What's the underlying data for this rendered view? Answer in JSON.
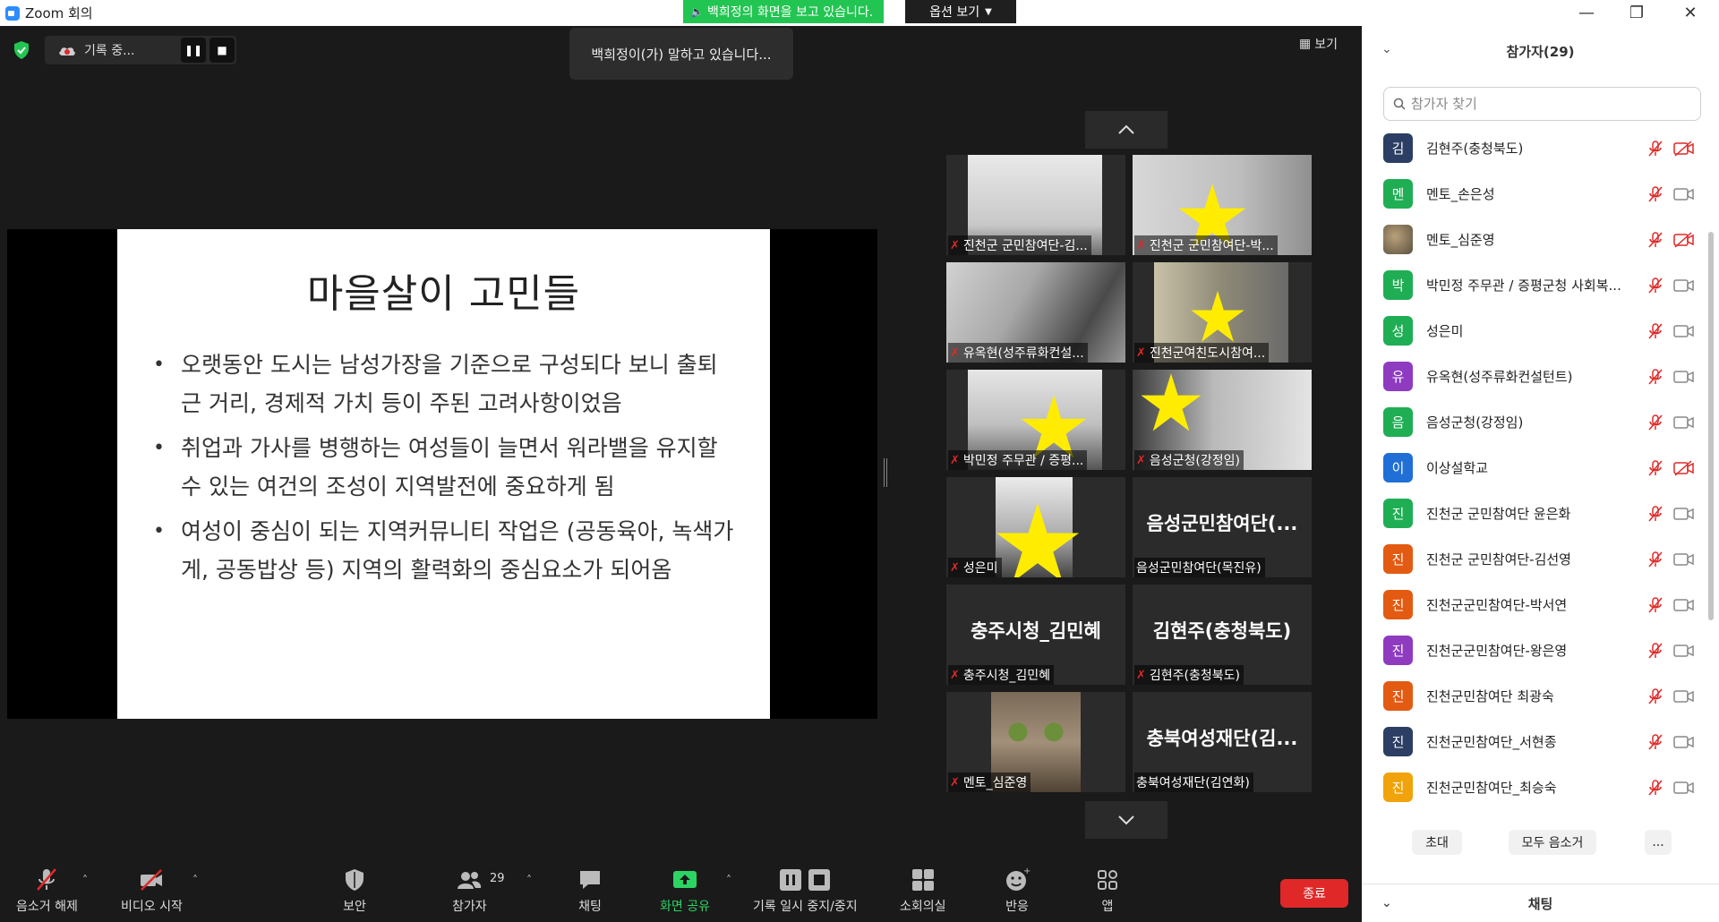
{
  "window": {
    "title": "Zoom 회의",
    "minimize": "—",
    "maximize": "❐",
    "close": "✕"
  },
  "banner": {
    "sharing_text": "백희정의 화면을 보고 있습니다.",
    "view_options": "옵션 보기"
  },
  "recording": {
    "text": "기록 중..."
  },
  "speaking": "백희정이(가) 말하고 있습니다...",
  "view_button": "보기",
  "slide": {
    "title": "마을살이 고민들",
    "bullets": [
      "오랫동안 도시는 남성가장을 기준으로 구성되다 보니 출퇴근 거리, 경제적 가치 등이 주된 고려사항이었음",
      "취업과 가사를 병행하는 여성들이 늘면서 워라밸을 유지할 수 있는 여건의 조성이 지역발전에 중요하게 됨",
      "여성이 중심이 되는 지역커뮤니티 작업은 (공동육아, 녹색가게, 공동밥상 등) 지역의 활력화의 중심요소가 되어옴"
    ]
  },
  "gallery": {
    "tiles": [
      {
        "label": "진천군 군민참여단-김...",
        "big": ""
      },
      {
        "label": "진천군 군민참여단-박...",
        "big": ""
      },
      {
        "label": "유옥현(성주류화컨설...",
        "big": ""
      },
      {
        "label": "진천군여친도시참여...",
        "big": ""
      },
      {
        "label": "박민정 주무관 / 증평...",
        "big": ""
      },
      {
        "label": "음성군청(강정임)",
        "big": ""
      },
      {
        "label": "성은미",
        "big": ""
      },
      {
        "label": "음성군민참여단(목진유)",
        "big": "음성군민참여단(..."
      },
      {
        "label": "충주시청_김민혜",
        "big": "충주시청_김민혜"
      },
      {
        "label": "김현주(충청북도)",
        "big": "김현주(충청북도)"
      },
      {
        "label": "멘토_심준영",
        "big": ""
      },
      {
        "label": "충북여성재단(김연화)",
        "big": "충북여성재단(김..."
      }
    ]
  },
  "toolbar": {
    "unmute": "음소거 해제",
    "start_video": "비디오 시작",
    "security": "보안",
    "participants": "참가자",
    "participants_count": "29",
    "chat": "채팅",
    "share_screen": "화면 공유",
    "pause_record": "기록 일시 중지/중지",
    "breakout": "소회의실",
    "reactions": "반응",
    "apps": "앱",
    "end": "종료"
  },
  "panel": {
    "header": "참가자(29)",
    "search_placeholder": "참가자 찾기",
    "participants": [
      {
        "initial": "김",
        "name": "김현주(충청북도)",
        "color": "#2c3e63",
        "cam_off": true
      },
      {
        "initial": "멘",
        "name": "멘토_손은성",
        "color": "#1fae54",
        "cam_off": false
      },
      {
        "initial": "",
        "name": "멘토_심준영",
        "color": "#6b6558",
        "cam_off": true
      },
      {
        "initial": "박",
        "name": "박민정 주무관 / 증평군청 사회복...",
        "color": "#1fae54",
        "cam_off": false
      },
      {
        "initial": "성",
        "name": "성은미",
        "color": "#1fae54",
        "cam_off": false
      },
      {
        "initial": "유",
        "name": "유옥현(성주류화컨설턴트)",
        "color": "#8e3bc0",
        "cam_off": false
      },
      {
        "initial": "음",
        "name": "음성군청(강정임)",
        "color": "#1fae54",
        "cam_off": false
      },
      {
        "initial": "이",
        "name": "이상설학교",
        "color": "#1f6fd6",
        "cam_off": true
      },
      {
        "initial": "진",
        "name": "진천군 군민참여단 윤은화",
        "color": "#1fae54",
        "cam_off": false
      },
      {
        "initial": "진",
        "name": "진천군 군민참여단-김선영",
        "color": "#e35a12",
        "cam_off": false
      },
      {
        "initial": "진",
        "name": "진천군군민참여단-박서연",
        "color": "#e35a12",
        "cam_off": false
      },
      {
        "initial": "진",
        "name": "진천군군민참여단-왕은영",
        "color": "#8e3bc0",
        "cam_off": false
      },
      {
        "initial": "진",
        "name": "진천군민참여단 최광숙",
        "color": "#e35a12",
        "cam_off": false
      },
      {
        "initial": "진",
        "name": "진천군민참여단_서현종",
        "color": "#2c3e63",
        "cam_off": false
      },
      {
        "initial": "진",
        "name": "진천군민참여단_최승숙",
        "color": "#f0a30a",
        "cam_off": false
      }
    ],
    "invite": "초대",
    "mute_all": "모두 음소거",
    "more": "...",
    "chat_header": "채팅"
  }
}
